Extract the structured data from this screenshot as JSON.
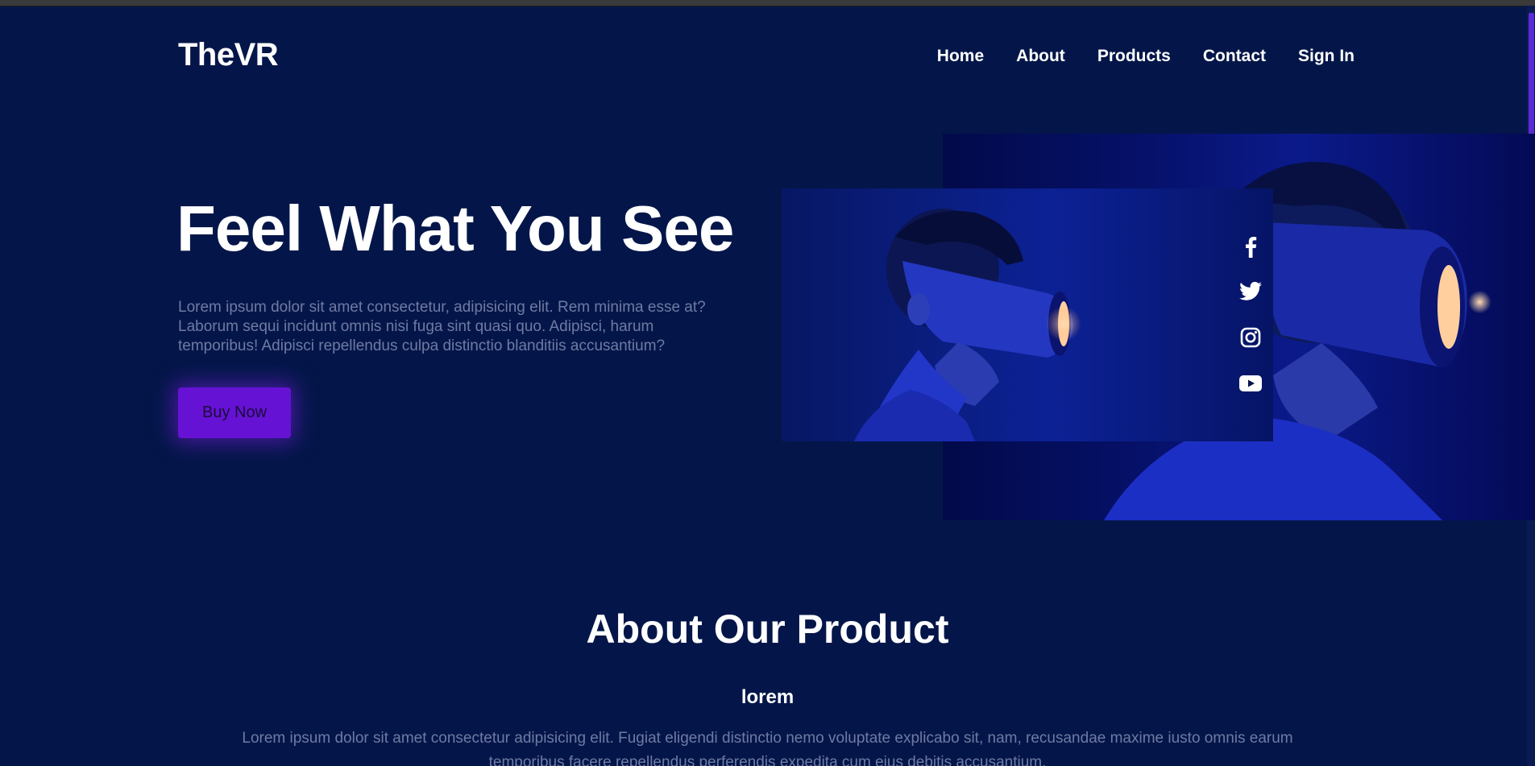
{
  "header": {
    "logo": "TheVR",
    "nav": [
      {
        "label": "Home"
      },
      {
        "label": "About"
      },
      {
        "label": "Products"
      },
      {
        "label": "Contact"
      },
      {
        "label": "Sign In"
      }
    ]
  },
  "hero": {
    "title": "Feel What You See",
    "text": "Lorem ipsum dolor sit amet consectetur, adipisicing elit. Rem minima esse at? Laborum sequi incidunt omnis nisi fuga sint quasi quo. Adipisci, harum temporibus! Adipisci repellendus culpa distinctio blanditiis accusantium?",
    "button_label": "Buy Now"
  },
  "social": [
    {
      "icon": "facebook-icon"
    },
    {
      "icon": "twitter-icon"
    },
    {
      "icon": "instagram-icon"
    },
    {
      "icon": "youtube-icon"
    }
  ],
  "about": {
    "title": "About Our Product",
    "subtitle": "lorem",
    "text": "Lorem ipsum dolor sit amet consectetur adipisicing elit. Fugiat eligendi distinctio nemo voluptate explicabo sit, nam, recusandae maxime iusto omnis earum temporibus facere repellendus perferendis expedita cum eius debitis accusantium."
  },
  "colors": {
    "background": "#041649",
    "accent": "#6612d4",
    "muted_text": "#6f7aa3"
  }
}
